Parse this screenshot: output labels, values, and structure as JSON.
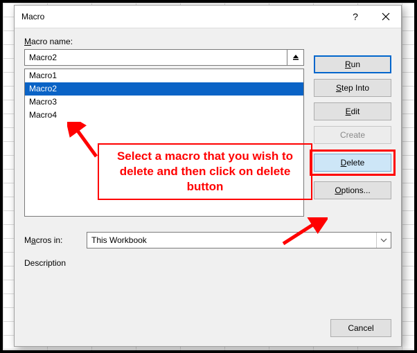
{
  "dialog": {
    "title": "Macro",
    "help_symbol": "?",
    "macro_name_label_prefix": "M",
    "macro_name_label_rest": "acro name:",
    "macro_name_value": "Macro2",
    "list": {
      "items": [
        "Macro1",
        "Macro2",
        "Macro3",
        "Macro4"
      ],
      "selected_index": 1
    },
    "buttons": {
      "run_u": "R",
      "run_rest": "un",
      "step_prefix": "",
      "step_u": "S",
      "step_rest": "tep Into",
      "edit_prefix": "",
      "edit_u": "E",
      "edit_rest": "dit",
      "create_prefix": "",
      "create_u": "C",
      "create_rest": "reate",
      "delete_prefix": "",
      "delete_u": "D",
      "delete_rest": "elete",
      "options_prefix": "",
      "options_u": "O",
      "options_rest": "ptions...",
      "cancel": "Cancel"
    },
    "macros_in_label_prefix": "M",
    "macros_in_label_u": "a",
    "macros_in_label_rest": "cros in:",
    "macros_in_value": "This Workbook",
    "description_label": "Description"
  },
  "annotation": {
    "text": "Select a macro that you wish to delete and then click on delete button"
  }
}
